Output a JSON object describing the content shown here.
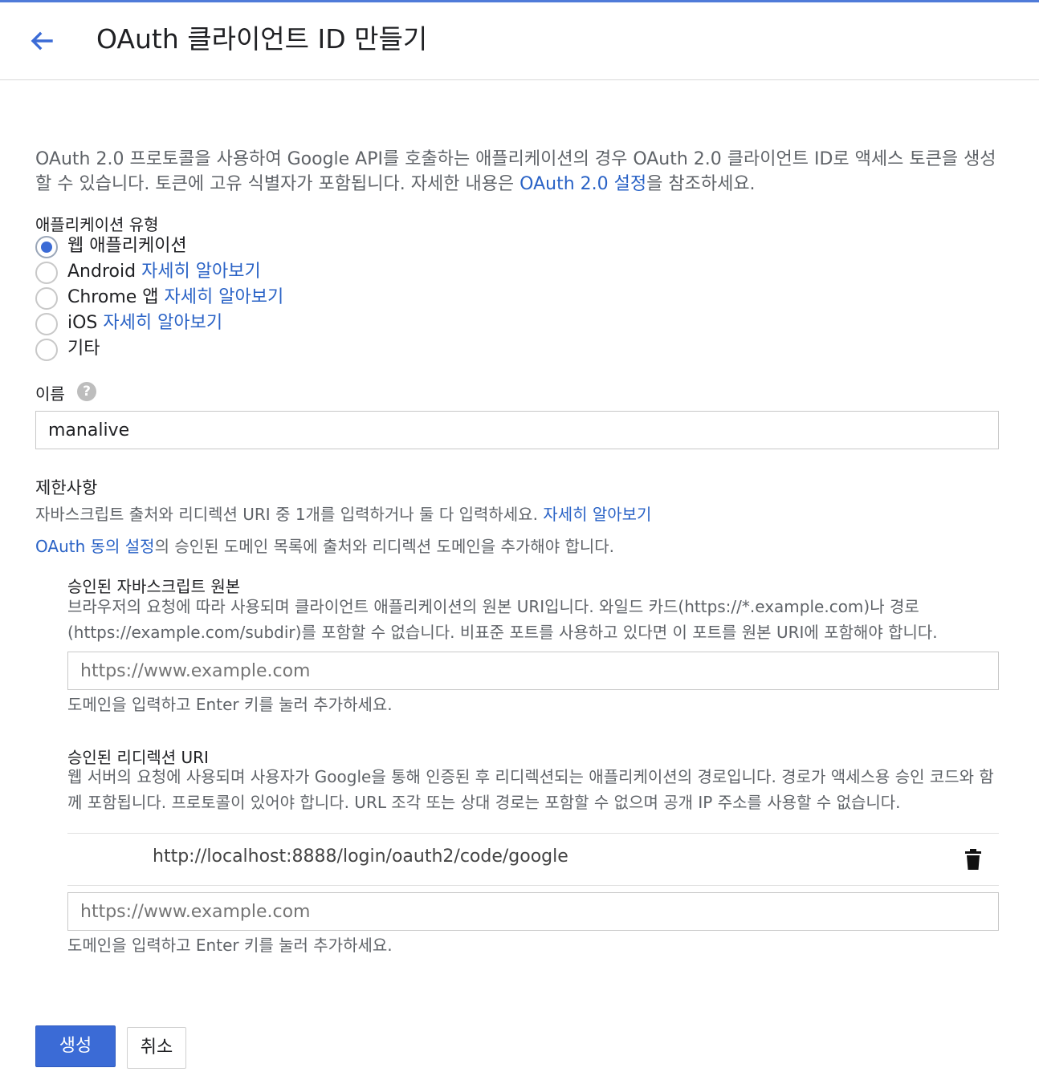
{
  "header": {
    "title": "OAuth 클라이언트 ID 만들기"
  },
  "intro": {
    "text_before": "OAuth 2.0 프로토콜을 사용하여 Google API를 호출하는 애플리케이션의 경우 OAuth 2.0 클라이언트 ID로 액세스 토큰을 생성할 수 있습니다. 토큰에 고유 식별자가 포함됩니다. 자세한 내용은 ",
    "link": "OAuth 2.0 설정",
    "text_after": "을 참조하세요."
  },
  "app_type": {
    "label": "애플리케이션 유형",
    "options": [
      {
        "label": "웹 애플리케이션",
        "link": "",
        "selected": true
      },
      {
        "label": "Android",
        "link": "자세히 알아보기",
        "selected": false
      },
      {
        "label": "Chrome 앱",
        "link": "자세히 알아보기",
        "selected": false
      },
      {
        "label": "iOS",
        "link": "자세히 알아보기",
        "selected": false
      },
      {
        "label": "기타",
        "link": "",
        "selected": false
      }
    ]
  },
  "name": {
    "label": "이름",
    "help_icon": "?",
    "value": "manalive"
  },
  "restrictions": {
    "title": "제한사항",
    "desc": "자바스크립트 출처와 리디렉션 URI 중 1개를 입력하거나 둘 다 입력하세요.",
    "desc_link": "자세히 알아보기",
    "consent_link": "OAuth 동의 설정",
    "consent_text": "의 승인된 도메인 목록에 출처와 리디렉션 도메인을 추가해야 합니다."
  },
  "js_origins": {
    "title": "승인된 자바스크립트 원본",
    "desc": "브라우저의 요청에 따라 사용되며 클라이언트 애플리케이션의 원본 URI입니다. 와일드 카드(https://*.example.com)나 경로(https://example.com/subdir)를 포함할 수 없습니다. 비표준 포트를 사용하고 있다면 이 포트를 원본 URI에 포함해야 합니다.",
    "placeholder": "https://www.example.com",
    "hint": "도메인을 입력하고 Enter 키를 눌러 추가하세요."
  },
  "redirect_uris": {
    "title": "승인된 리디렉션 URI",
    "desc": "웹 서버의 요청에 사용되며 사용자가 Google을 통해 인증된 후 리디렉션되는 애플리케이션의 경로입니다. 경로가 액세스용 승인 코드와 함께 포함됩니다. 프로토콜이 있어야 합니다. URL 조각 또는 상대 경로는 포함할 수 없으며 공개 IP 주소를 사용할 수 없습니다.",
    "entries": [
      "http://localhost:8888/login/oauth2/code/google"
    ],
    "placeholder": "https://www.example.com",
    "hint": "도메인을 입력하고 Enter 키를 눌러 추가하세요."
  },
  "actions": {
    "create": "생성",
    "cancel": "취소"
  },
  "colors": {
    "accent": "#3b6bd6",
    "link": "#2962c6",
    "top_bar": "#4f7bd9"
  },
  "icons": {
    "back": "arrow-back-icon",
    "help": "help-icon",
    "delete": "trash-icon"
  }
}
